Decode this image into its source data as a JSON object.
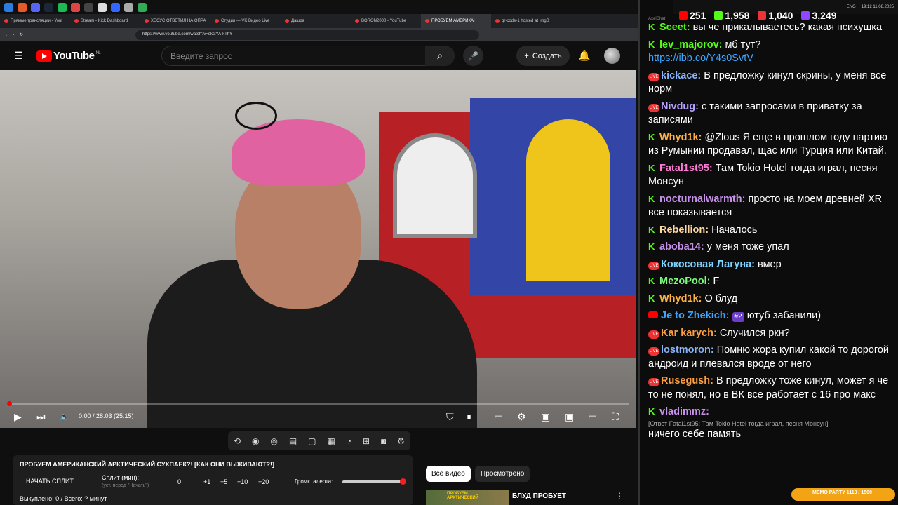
{
  "browser": {
    "tabs": [
      {
        "label": "Прямые трансляции - Youl"
      },
      {
        "label": "Stream - Kick Dashboard"
      },
      {
        "label": "ХЕСУС ОТВЕТИЛ НА ОПРА"
      },
      {
        "label": "Студия — VK Видео Live"
      },
      {
        "label": "Дашра"
      },
      {
        "label": "BORON2000 - YouTube"
      },
      {
        "label": "ПРОБУЕМ АМЕРИКАН"
      },
      {
        "label": "qr-code-1 hosted at ImgB"
      }
    ],
    "url": "https://www.youtube.com/watch?v=skctYA-kThY"
  },
  "youtube": {
    "logo_text": "YouTube",
    "region": "NL",
    "search_placeholder": "Введите запрос",
    "create_label": "Создать",
    "player": {
      "time": "0:00 / 28:03 (25:15)",
      "progress_fraction": 0.0
    },
    "panel": {
      "title": "ПРОБУЕМ АМЕРИКАНСКИЙ АРКТИЧЕСКИЙ СУХПАЕК?! [КАК ОНИ ВЫЖИВАЮТ?!]",
      "split_button": "НАЧАТЬ СПЛИТ",
      "split_label": "Сплит (мин):",
      "split_sub": "(уст. перед \"Начать\")",
      "split_value": "0",
      "increments": [
        "+1",
        "+5",
        "+10",
        "+20"
      ],
      "alert_label": "Громк. алерта:",
      "status": "Выкуплено: 0 / Всего: ? минут"
    },
    "chips": [
      "Все видео",
      "Просмотрено"
    ],
    "related_title": "БЛУД ПРОБУЕТ",
    "thumb_text": "ПРОБУЕМ АРКТИЧЕСКИЙ"
  },
  "system": {
    "time": "19:12",
    "date": "11.08.2025",
    "lang": "ENG",
    "app": "AxelChat"
  },
  "stats": [
    {
      "icon": "youtube-icon",
      "value": "251",
      "color": "#ff0000"
    },
    {
      "icon": "kick-icon",
      "value": "1,958",
      "color": "#53fc18"
    },
    {
      "icon": "vk-live-icon",
      "value": "1,040",
      "color": "#e33"
    },
    {
      "icon": "twitch-icon",
      "value": "3,249",
      "color": "#9146ff"
    }
  ],
  "chat": [
    {
      "platform": "kick",
      "name": "Sceet:",
      "color": "#53fc18",
      "text": "вы че прикалываетесь? какая психушка"
    },
    {
      "platform": "kick",
      "name": "lev_majorov:",
      "color": "#53fc18",
      "text": "мб тут?",
      "link": "https://ibb.co/Y4s0SvtV"
    },
    {
      "platform": "vk",
      "name": "kickace:",
      "color": "#8ab4f8",
      "text": "В предложку кинул скрины, у меня все норм"
    },
    {
      "platform": "vk",
      "name": "Nivdug:",
      "color": "#b7a4ff",
      "text": "с такими запросами в приватку за записями"
    },
    {
      "platform": "kick",
      "name": "Whyd1k:",
      "color": "#ffb347",
      "text": "@Zlous Я еще в прошлом году партию из Румынии продавал, щас или Турция или Китай."
    },
    {
      "platform": "kick",
      "name": "Fatal1st95:",
      "color": "#ff7bd5",
      "text": "Там Tokio Hotel тогда играл, песня Монсун"
    },
    {
      "platform": "kick",
      "name": "nocturnalwarmth:",
      "color": "#c792ea",
      "text": "просто на моем древней XR все показывается"
    },
    {
      "platform": "kick",
      "name": "Rebellion:",
      "color": "#ffd7a0",
      "text": "Началось"
    },
    {
      "platform": "kick",
      "name": "aboba14:",
      "color": "#c792ea",
      "text": "у меня тоже упал"
    },
    {
      "platform": "vk",
      "name": "Кокосовая Лагуна:",
      "color": "#7fd3ff",
      "text": "вмер"
    },
    {
      "platform": "kick",
      "name": "MezoPool:",
      "color": "#7cfc7c",
      "text": "F"
    },
    {
      "platform": "kick",
      "name": "Whyd1k:",
      "color": "#ffb347",
      "text": "О блуд"
    },
    {
      "platform": "youtube",
      "name": "Je to Zhekich:",
      "color": "#3ea6ff",
      "badge": "#2",
      "text": "ютуб забанили)"
    },
    {
      "platform": "vk",
      "name": "Kar karych:",
      "color": "#ff9f43",
      "text": "Случился ркн?"
    },
    {
      "platform": "vk",
      "name": "lostmoron:",
      "color": "#8ab4f8",
      "text": "Помню жора купил какой то дорогой андроид и плевался вроде от него"
    },
    {
      "platform": "vk",
      "name": "Rusegush:",
      "color": "#ff9f43",
      "text": "В предложку тоже кинул, может я че то не понял, но в ВК все работает с 16 про макс"
    },
    {
      "platform": "kick",
      "name": "vladimmz:",
      "color": "#c792ea",
      "reply": "[Ответ Fatal1st95: Там Tokio Hotel тогда играл, песня Монсун]",
      "text": "ничего себе память"
    }
  ],
  "memo": {
    "label": "MEMO PARTY",
    "value": "1110 / 1500"
  }
}
